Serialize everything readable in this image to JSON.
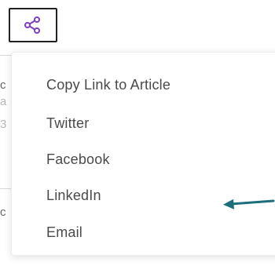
{
  "share_button": {
    "icon": "share-icon",
    "icon_color": "#7e3fbd"
  },
  "background_fragments": [
    {
      "text": "c"
    },
    {
      "text": "a"
    },
    {
      "text": "3"
    },
    {
      "text": "c"
    }
  ],
  "share_menu": {
    "items": [
      {
        "label": "Copy Link to Article"
      },
      {
        "label": "Twitter"
      },
      {
        "label": "Facebook"
      },
      {
        "label": "LinkedIn"
      },
      {
        "label": "Email"
      }
    ]
  },
  "annotation": {
    "icon": "arrow-left-icon",
    "color": "#1c6e7a"
  }
}
